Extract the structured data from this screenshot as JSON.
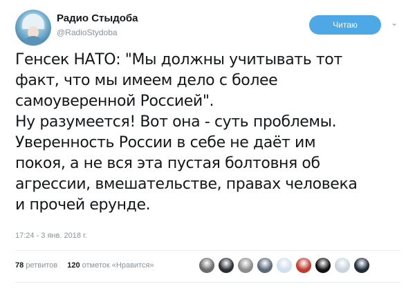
{
  "tweet": {
    "author_name": "Радио Стыдоба",
    "author_handle": "@RadioStydoba",
    "follow_label": "Читаю",
    "lines": [
      "Генсек НАТО: \"Мы должны учитывать тот",
      "факт, что мы имеем дело с более",
      "самоуверенной Россией\".",
      "Ну разумеется! Вот она - суть проблемы.",
      "Уверенность России в себе не даёт им",
      "покоя, а не вся эта пустая болтовня об",
      "агрессии, вмешательстве, правах человека",
      "и прочей ерунде."
    ],
    "timestamp": "17:24 - 3 янв. 2018 г."
  },
  "stats": {
    "retweets_count": "78",
    "retweets_label": "ретвитов",
    "likes_count": "120",
    "likes_label": "отметок «Нравится»"
  },
  "likers": [
    {
      "icon": "avatar-gray-icon",
      "color": "#6b6b6b"
    },
    {
      "icon": "avatar-dark-icon",
      "color": "#2b2f33"
    },
    {
      "icon": "avatar-gray2-icon",
      "color": "#8c8c8c"
    },
    {
      "icon": "avatar-eye-icon",
      "color": "#5a6a78"
    },
    {
      "icon": "avatar-flag-icon",
      "color": "#d0dfee"
    },
    {
      "icon": "avatar-red-icon",
      "color": "#c23a2e"
    },
    {
      "icon": "avatar-black-icon",
      "color": "#111111"
    },
    {
      "icon": "avatar-default-icon",
      "color": "#c8d4de"
    },
    {
      "icon": "avatar-darkblue-icon",
      "color": "#1f2d3a"
    }
  ]
}
